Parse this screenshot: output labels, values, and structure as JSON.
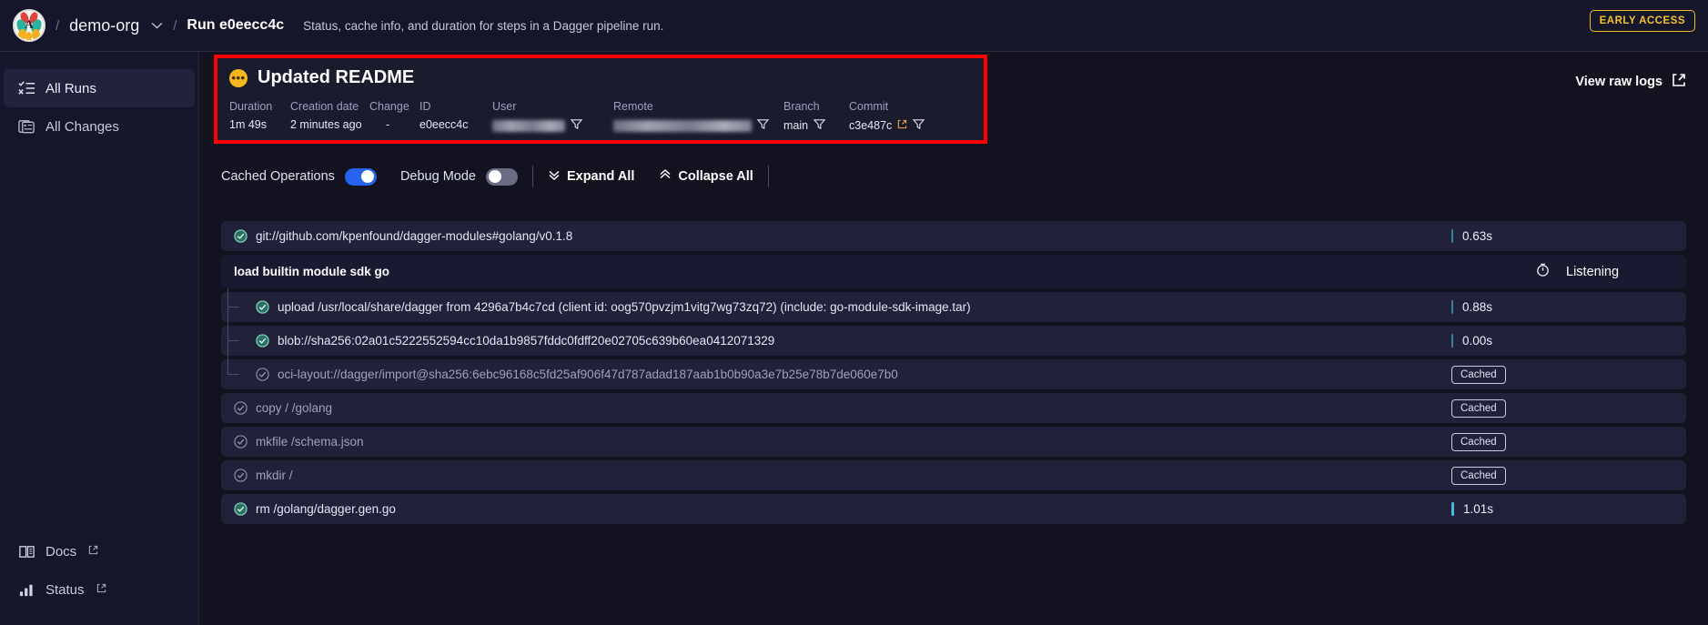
{
  "topbar": {
    "logo_letter": "A",
    "separator": "/",
    "org": "demo-org",
    "org_dropdown_icon": "chevron-down-icon",
    "run_title": "Run e0eecc4c",
    "run_description": "Status, cache info, and duration for steps in a Dagger pipeline run.",
    "early_access_badge": "EARLY ACCESS"
  },
  "sidebar": {
    "items": [
      {
        "label": "All Runs",
        "icon": "list-checks-icon",
        "active": true,
        "external": false
      },
      {
        "label": "All Changes",
        "icon": "changes-icon",
        "active": false,
        "external": false
      }
    ],
    "bottom_items": [
      {
        "label": "Docs",
        "icon": "book-icon",
        "external": true
      },
      {
        "label": "Status",
        "icon": "bar-chart-icon",
        "external": true
      }
    ],
    "external_icon": "external-link-icon"
  },
  "run_info": {
    "status_icon": "pending-dots-icon",
    "status_color": "#f5b81c",
    "name": "Updated README",
    "highlight_color": "#ff0000",
    "fields": [
      {
        "label": "Duration",
        "value": "1m 49s",
        "filter": false,
        "link": false
      },
      {
        "label": "Creation date",
        "value": "2 minutes ago",
        "filter": false,
        "link": false
      },
      {
        "label": "Change",
        "value": "-",
        "filter": false,
        "link": false
      },
      {
        "label": "ID",
        "value": "e0eecc4c",
        "filter": false,
        "link": false
      },
      {
        "label": "User",
        "value": "",
        "redacted": true,
        "filter": true,
        "link": false
      },
      {
        "label": "Remote",
        "value": "",
        "redacted": true,
        "filter": true,
        "link": false
      },
      {
        "label": "Branch",
        "value": "main",
        "filter": true,
        "link": false
      },
      {
        "label": "Commit",
        "value": "c3e487c",
        "filter": true,
        "link": true
      }
    ],
    "view_raw_logs": "View raw logs",
    "view_raw_logs_icon": "external-link-icon"
  },
  "toolbar": {
    "cached_operations_label": "Cached Operations",
    "cached_operations_on": true,
    "debug_mode_label": "Debug Mode",
    "debug_mode_on": false,
    "expand_all": "Expand All",
    "expand_all_icon": "chevron-double-down-icon",
    "collapse_all": "Collapse All",
    "collapse_all_icon": "chevron-double-up-icon"
  },
  "rows": [
    {
      "text": "git://github.com/kpenfound/dagger-modules#golang/v0.1.8",
      "status": "success",
      "kind": "step",
      "depth": 0,
      "right_type": "duration",
      "right_value": "0.63s"
    },
    {
      "text": "load builtin module sdk go",
      "status": "none",
      "kind": "group",
      "depth": 0,
      "right_type": "listening",
      "right_value": "Listening",
      "right_icon": "stopwatch-icon"
    },
    {
      "text": "upload /usr/local/share/dagger from 4296a7b4c7cd (client id: oog570pvzjm1vitg7wg73zq72) (include: go-module-sdk-image.tar)",
      "status": "success",
      "kind": "step",
      "depth": 1,
      "right_type": "duration",
      "right_value": "0.88s"
    },
    {
      "text": "blob://sha256:02a01c5222552594cc10da1b9857fddc0fdff20e02705c639b60ea0412071329",
      "status": "success",
      "kind": "step",
      "depth": 1,
      "right_type": "duration",
      "right_value": "0.00s"
    },
    {
      "text": "oci-layout://dagger/import@sha256:6ebc96168c5fd25af906f47d787adad187aab1b0b90a3e7b25e78b7de060e7b0",
      "status": "cached",
      "kind": "step",
      "depth": 1,
      "right_type": "cached",
      "right_value": "Cached"
    },
    {
      "text": "copy / /golang",
      "status": "cached",
      "kind": "step",
      "depth": 0,
      "right_type": "cached",
      "right_value": "Cached"
    },
    {
      "text": "mkfile /schema.json",
      "status": "cached",
      "kind": "step",
      "depth": 0,
      "right_type": "cached",
      "right_value": "Cached"
    },
    {
      "text": "mkdir /",
      "status": "cached",
      "kind": "step",
      "depth": 0,
      "right_type": "cached",
      "right_value": "Cached"
    },
    {
      "text": "rm /golang/dagger.gen.go",
      "status": "success",
      "kind": "step",
      "depth": 0,
      "right_type": "duration",
      "right_value": "1.01s"
    }
  ]
}
